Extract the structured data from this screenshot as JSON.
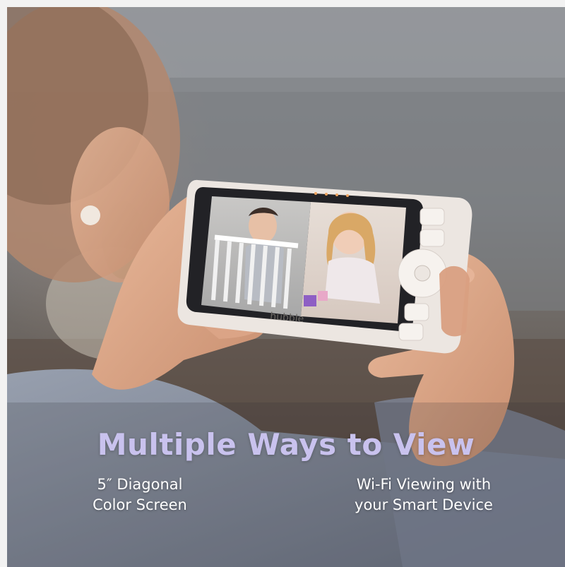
{
  "headline": "Multiple Ways to View",
  "features": [
    {
      "line1": "5″ Diagonal",
      "line2": "Color Screen"
    },
    {
      "line1": "Wi-Fi Viewing with",
      "line2": "your Smart Device"
    }
  ],
  "device": {
    "brand_logo": "hubble",
    "icons": [
      "camera-icon",
      "menu-icon",
      "dpad-icon",
      "microphone-icon",
      "power-icon"
    ]
  },
  "colors": {
    "headline": "#c9c2ee",
    "feature_text": "#ffffff",
    "device_body": "#ece6e1"
  }
}
